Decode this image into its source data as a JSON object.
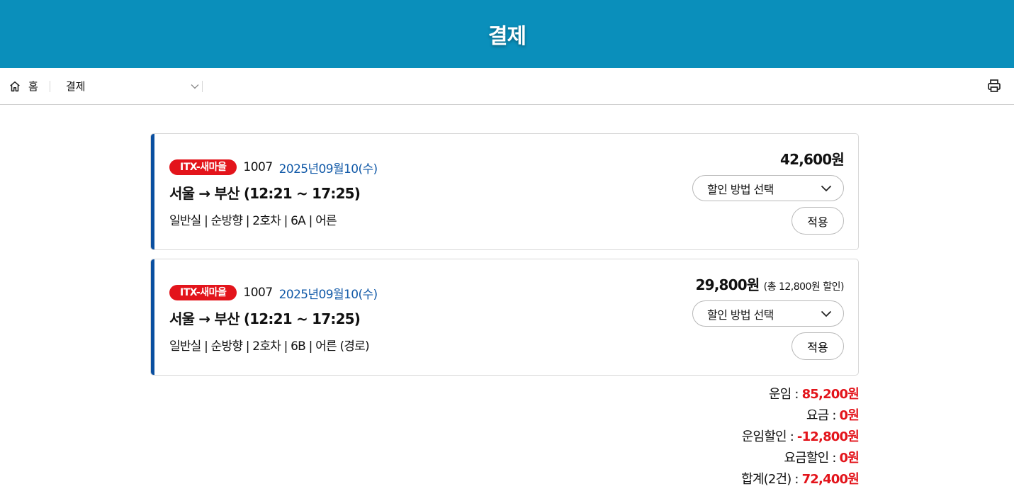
{
  "header": {
    "title": "결제"
  },
  "breadcrumb": {
    "home_label": "홈",
    "current_label": "결제"
  },
  "colors": {
    "header_bg": "#0a8fbb",
    "badge": "#e3141b",
    "date": "#125aa8",
    "accent": "#0a4fa0",
    "amount": "#e3141b"
  },
  "tickets": [
    {
      "badge": "ITX-새마을",
      "train_no": "1007",
      "date": "2025년09월10(수)",
      "route": "서울 → 부산 (12:21 ~ 17:25)",
      "detail": "일반실 | 순방향 | 2호차 | 6A | 어른",
      "price": "42,600원",
      "price_note": "",
      "discount_select": "할인 방법 선택",
      "apply_label": "적용"
    },
    {
      "badge": "ITX-새마을",
      "train_no": "1007",
      "date": "2025년09월10(수)",
      "route": "서울 → 부산 (12:21 ~ 17:25)",
      "detail": "일반실 | 순방향 | 2호차 | 6B | 어른 (경로)",
      "price": "29,800원",
      "price_note": "(총 12,800원 할인)",
      "discount_select": "할인 방법 선택",
      "apply_label": "적용"
    }
  ],
  "summary": [
    {
      "label": "운임 : ",
      "value": "85,200원"
    },
    {
      "label": "요금 : ",
      "value": "0원"
    },
    {
      "label": "운임할인 : ",
      "value": "-12,800원"
    },
    {
      "label": "요금할인 : ",
      "value": "0원"
    },
    {
      "label": "합계(2건) : ",
      "value": "72,400원"
    }
  ],
  "icons": [
    "home-icon",
    "chevron-down-icon",
    "print-icon"
  ]
}
